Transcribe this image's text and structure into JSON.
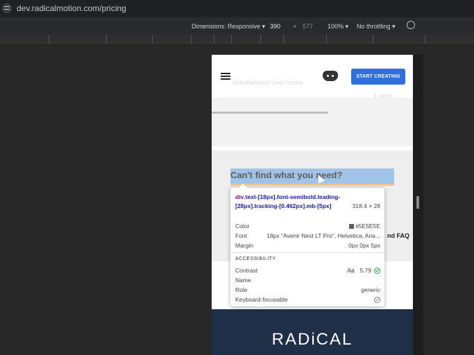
{
  "address_bar": {
    "url": "dev.radicalmotion.com/pricing"
  },
  "device_toolbar": {
    "dimensions": "Dimensions: Responsive ▾",
    "width": "390",
    "times": "×",
    "height": "577",
    "zoom": "100% ▾",
    "throttling": "No throttling ▾"
  },
  "page": {
    "ghost_text_1": "Simultaneous Live rooms",
    "ghost_text_2": "1 room",
    "cta_label": "START CREATING",
    "heading": "Can't find what you need?",
    "faq_fragment": "nd FAQ",
    "logo": "RADiCAL"
  },
  "inspector_tooltip": {
    "selector_tag": "div",
    "selector_classes": ".text-[18px].font-semibold.leading-[28px].tracking-[0.462px].mb-[5px]",
    "size": "318.4 × 28",
    "color_label": "Color",
    "color_value": "#5E5E5E",
    "font_label": "Font",
    "font_value": "18px \"Avenir Next LT Pro\", Helvetica, Aria...",
    "margin_label": "Margin",
    "margin_value": "0px 0px 5px",
    "accessibility_title": "ACCESSIBILITY",
    "contrast_label": "Contrast",
    "contrast_aa": "Aa",
    "contrast_value": "5.79",
    "name_label": "Name",
    "role_label": "Role",
    "role_value": "generic",
    "keyboard_label": "Keyboard-focusable"
  },
  "colors": {
    "cta": "#2f6fde",
    "heading_text": "#5E5E5E",
    "highlight": "#9fc4e7",
    "footer": "#1e2f47"
  }
}
